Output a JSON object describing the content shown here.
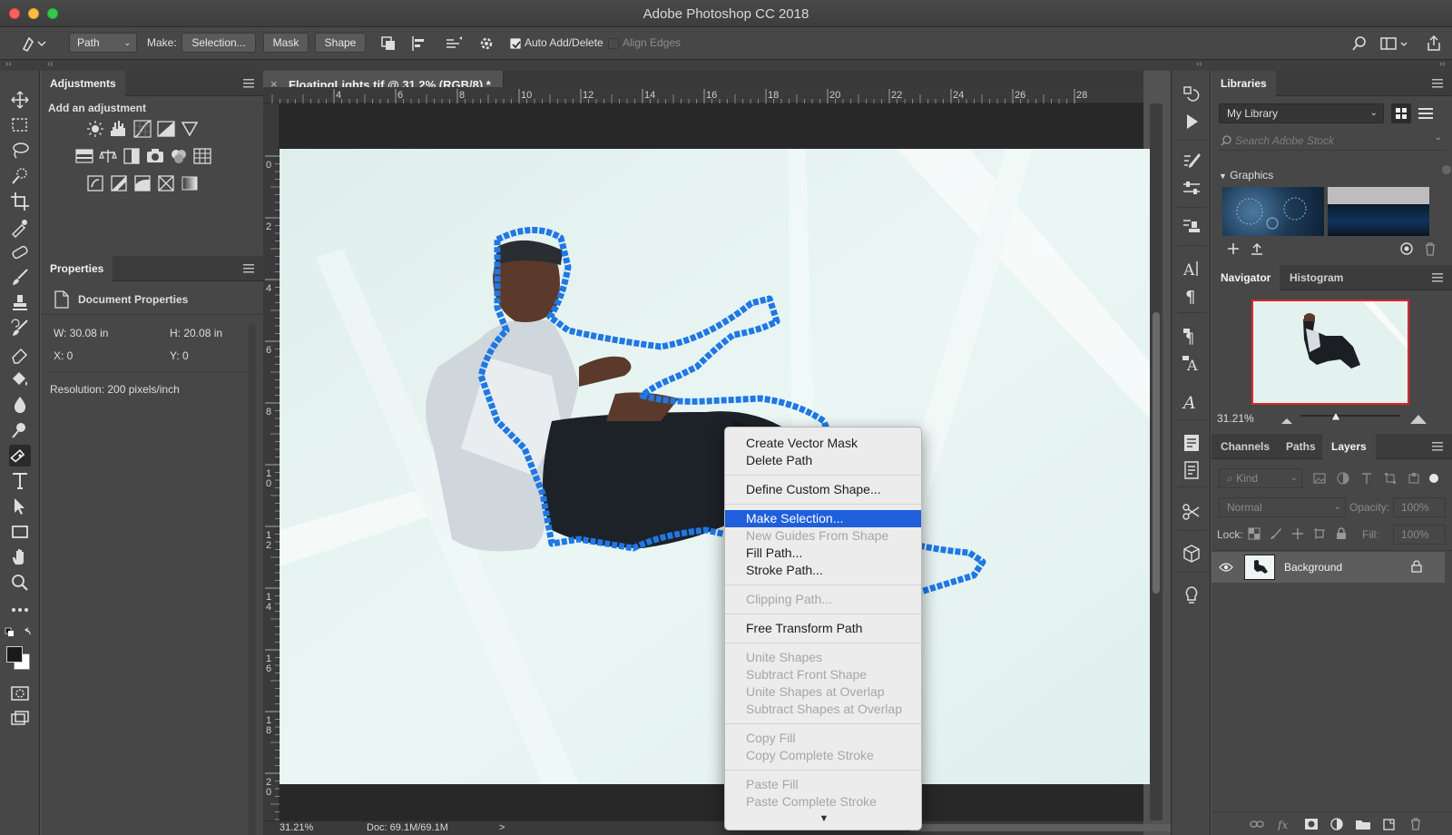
{
  "window": {
    "title": "Adobe Photoshop CC 2018"
  },
  "options_bar": {
    "tool_mode": "Path",
    "make_label": "Make:",
    "buttons": [
      "Selection...",
      "Mask",
      "Shape"
    ],
    "auto_add_delete": {
      "label": "Auto Add/Delete",
      "checked": true
    },
    "align_edges": {
      "label": "Align Edges",
      "checked": false
    }
  },
  "adjustments": {
    "tab": "Adjustments",
    "subtitle": "Add an adjustment"
  },
  "properties": {
    "tab": "Properties",
    "header": "Document Properties",
    "w": "W:  30.08 in",
    "h": "H:  20.08 in",
    "x": "X:  0",
    "y": "Y:  0",
    "resolution": "Resolution: 200 pixels/inch"
  },
  "document": {
    "tab_title": "FloatingLights.tif @ 31.2% (RGB/8) *",
    "close": "×"
  },
  "ruler_top": [
    "4",
    "6",
    "8",
    "10",
    "12",
    "14",
    "16",
    "18",
    "20",
    "22",
    "24",
    "26",
    "28"
  ],
  "ruler_left": [
    "0",
    "2",
    "4",
    "6",
    "8",
    "1 0",
    "1 2",
    "1 4",
    "1 6",
    "1 8",
    "2 0"
  ],
  "status": {
    "zoom": "31.21%",
    "doc": "Doc: 69.1M/69.1M",
    "arrow": ">"
  },
  "libraries": {
    "tab": "Libraries",
    "library": "My Library",
    "search_placeholder": "Search Adobe Stock",
    "section": "Graphics"
  },
  "navigator": {
    "tabs": [
      "Navigator",
      "Histogram"
    ],
    "zoom": "31.21%",
    "zoom_level": 0.35
  },
  "layers": {
    "tabs": [
      "Channels",
      "Paths",
      "Layers"
    ],
    "filter": "Kind",
    "blend": "Normal",
    "opacity_label": "Opacity:",
    "opacity": "100%",
    "lock_label": "Lock:",
    "fill_label": "Fill:",
    "fill": "100%",
    "layer_name": "Background"
  },
  "context_menu": {
    "groups": [
      [
        {
          "label": "Create Vector Mask",
          "enabled": true
        },
        {
          "label": "Delete Path",
          "enabled": true
        }
      ],
      [
        {
          "label": "Define Custom Shape...",
          "enabled": true
        }
      ],
      [
        {
          "label": "Make Selection...",
          "enabled": true,
          "highlighted": true
        },
        {
          "label": "New Guides From Shape",
          "enabled": false
        },
        {
          "label": "Fill Path...",
          "enabled": true
        },
        {
          "label": "Stroke Path...",
          "enabled": true
        }
      ],
      [
        {
          "label": "Clipping Path...",
          "enabled": false
        }
      ],
      [
        {
          "label": "Free Transform Path",
          "enabled": true
        }
      ],
      [
        {
          "label": "Unite Shapes",
          "enabled": false
        },
        {
          "label": "Subtract Front Shape",
          "enabled": false
        },
        {
          "label": "Unite Shapes at Overlap",
          "enabled": false
        },
        {
          "label": "Subtract Shapes at Overlap",
          "enabled": false
        }
      ],
      [
        {
          "label": "Copy Fill",
          "enabled": false
        },
        {
          "label": "Copy Complete Stroke",
          "enabled": false
        }
      ],
      [
        {
          "label": "Paste Fill",
          "enabled": false
        },
        {
          "label": "Paste Complete Stroke",
          "enabled": false
        }
      ]
    ],
    "more": "▼"
  },
  "colors": {
    "accent": "#1f5fdc",
    "path": "#1e78e6",
    "canvas": "#e3f1ef"
  }
}
